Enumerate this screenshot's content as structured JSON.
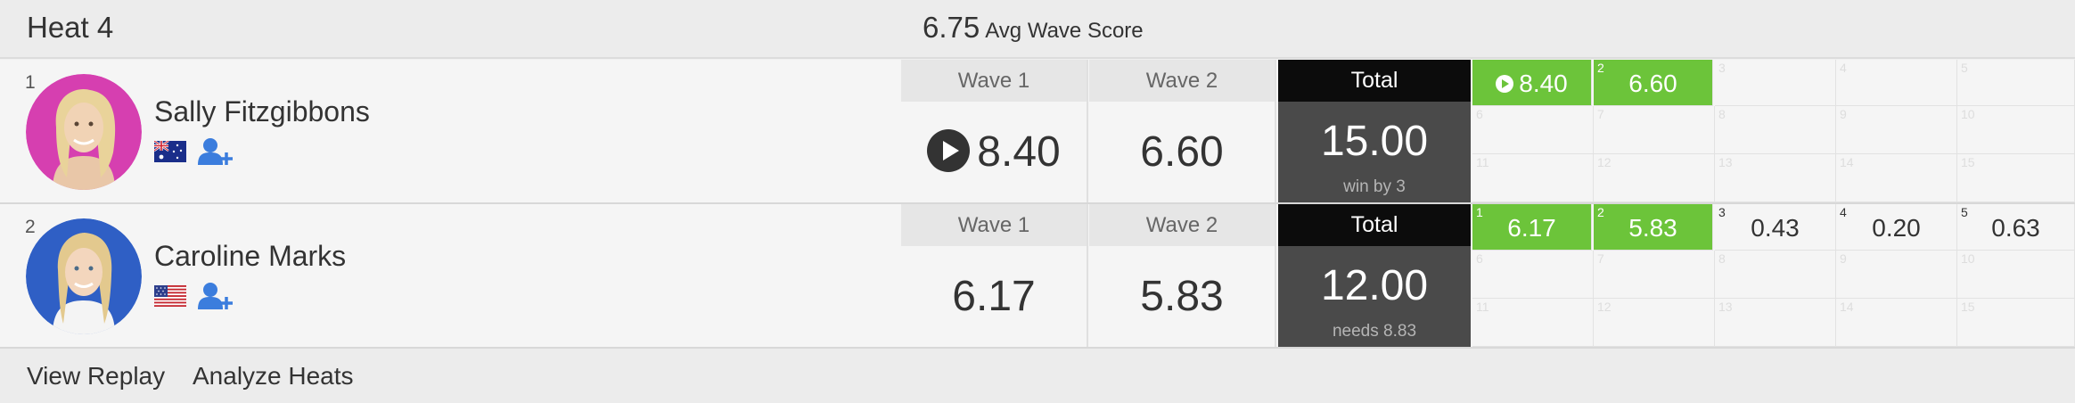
{
  "header": {
    "heat_title": "Heat 4",
    "avg_score": "6.75",
    "avg_label": "Avg Wave Score"
  },
  "colors": {
    "green": "#6cc43a",
    "total_bg": "#4a4a4a",
    "total_head": "#0c0c0c",
    "avatar1_bg": "#d63fb0",
    "avatar2_bg": "#2f5fc5"
  },
  "athletes": [
    {
      "seed": "1",
      "name": "Sally Fitzgibbons",
      "flag": "australia-flag",
      "wave1_label": "Wave 1",
      "wave1_score": "8.40",
      "wave2_label": "Wave 2",
      "wave2_score": "6.60",
      "total_label": "Total",
      "total_score": "15.00",
      "total_note": "win by 3",
      "waves": [
        {
          "num": "1",
          "score": "8.40",
          "counting": true,
          "has_replay": true
        },
        {
          "num": "2",
          "score": "6.60",
          "counting": true
        },
        {
          "num": "3",
          "score": ""
        },
        {
          "num": "4",
          "score": ""
        },
        {
          "num": "5",
          "score": ""
        }
      ]
    },
    {
      "seed": "2",
      "name": "Caroline Marks",
      "flag": "usa-flag",
      "wave1_label": "Wave 1",
      "wave1_score": "6.17",
      "wave2_label": "Wave 2",
      "wave2_score": "5.83",
      "total_label": "Total",
      "total_score": "12.00",
      "total_note": "needs 8.83",
      "waves": [
        {
          "num": "1",
          "score": "6.17",
          "counting": true
        },
        {
          "num": "2",
          "score": "5.83",
          "counting": true
        },
        {
          "num": "3",
          "score": "0.43"
        },
        {
          "num": "4",
          "score": "0.20"
        },
        {
          "num": "5",
          "score": "0.63"
        }
      ]
    }
  ],
  "grid_numbers": {
    "row2": [
      "6",
      "7",
      "8",
      "9",
      "10"
    ],
    "row3": [
      "11",
      "12",
      "13",
      "14",
      "15"
    ]
  },
  "footer": {
    "view_replay": "View Replay",
    "analyze_heats": "Analyze Heats"
  }
}
